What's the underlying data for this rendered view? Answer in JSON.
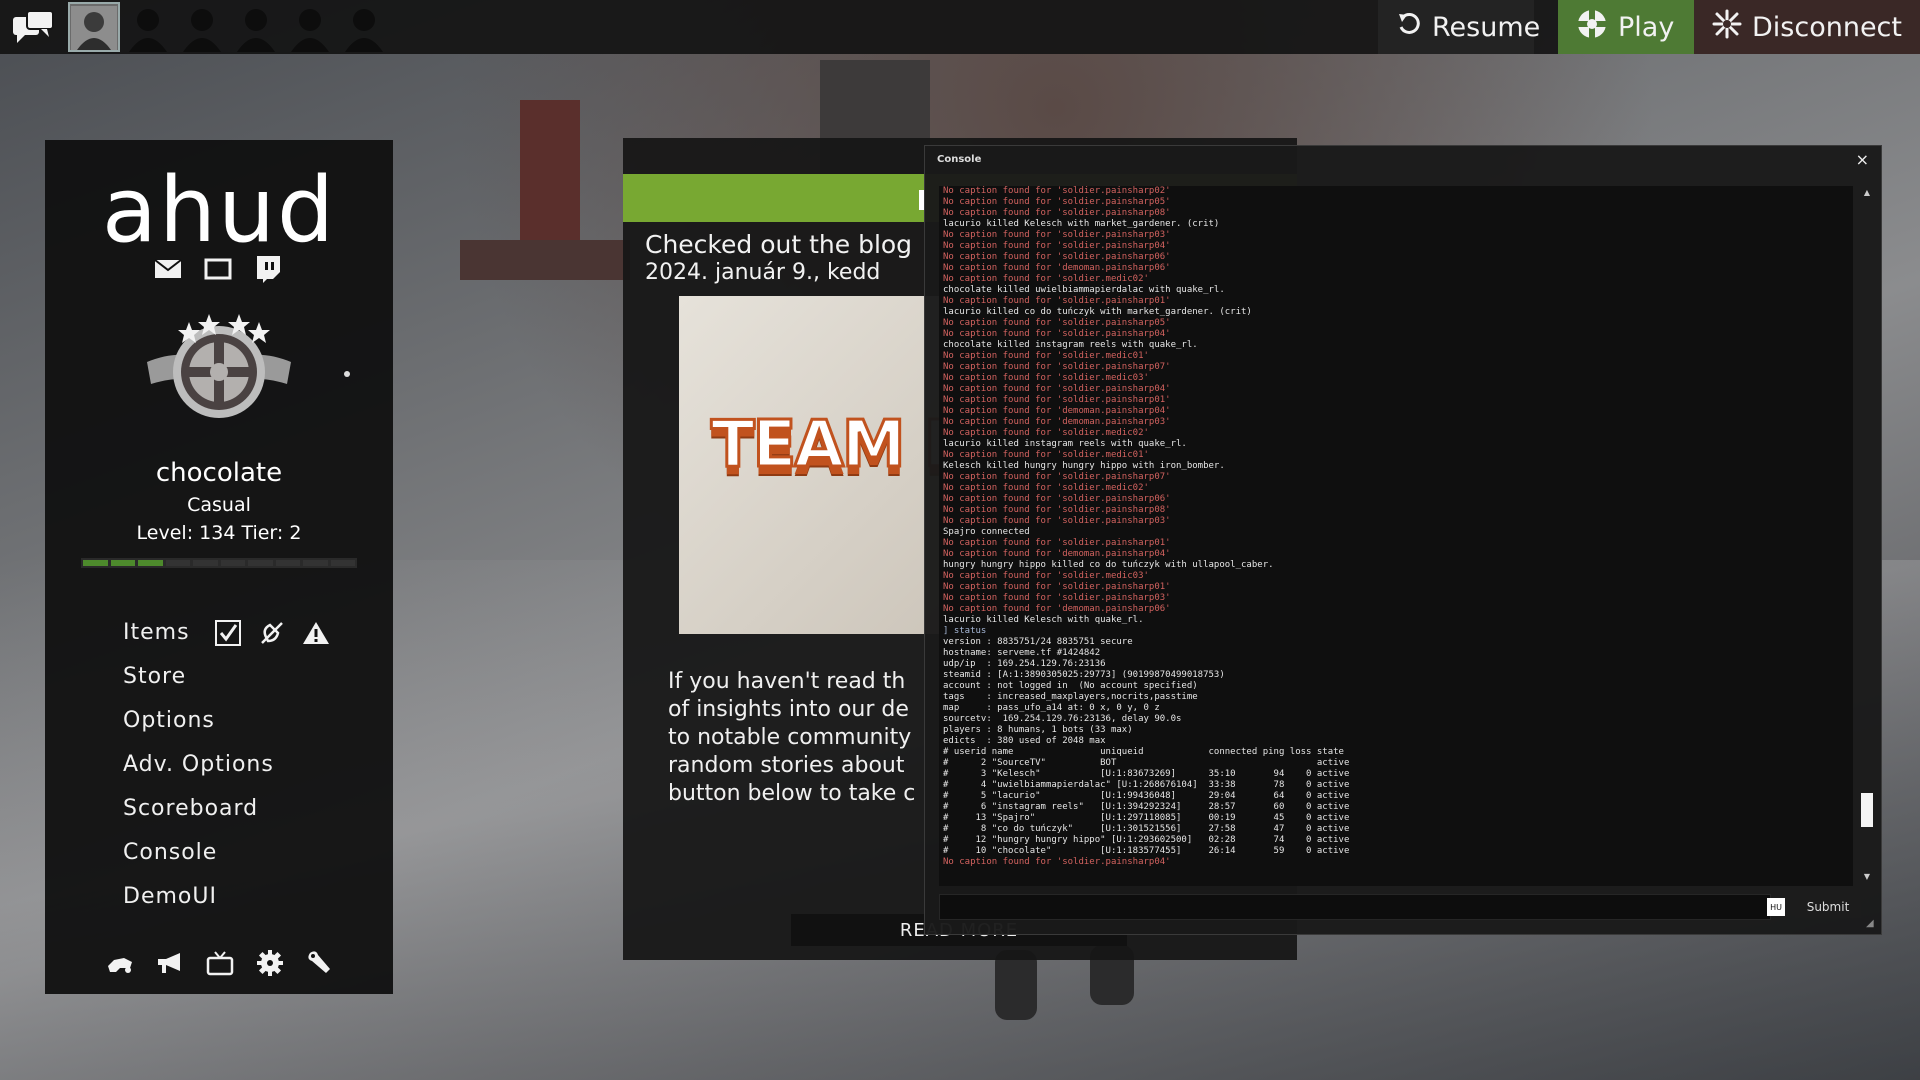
{
  "topbar": {
    "chat_icon": "chat-bubbles-icon",
    "friend_count": 5,
    "buttons": {
      "resume": "Resume",
      "play": "Play",
      "disconnect": "Disconnect"
    }
  },
  "menu": {
    "logo": "ahud",
    "player": {
      "name": "chocolate",
      "mode": "Casual",
      "level": "Level: 134 Tier: 2",
      "xp_segments_filled": 3,
      "xp_segments_total": 10
    },
    "items": [
      {
        "label": "Items"
      },
      {
        "label": "Store"
      },
      {
        "label": "Options"
      },
      {
        "label": "Adv. Options"
      },
      {
        "label": "Scoreboard"
      },
      {
        "label": "Console"
      },
      {
        "label": "DemoUI"
      }
    ]
  },
  "blog": {
    "title": "Checked out the blog",
    "date": "2024. január 9., kedd",
    "image_text": "TEAM FO",
    "body": [
      "If you haven't read th",
      "of insights into our de",
      "to notable community",
      "random stories about",
      "button below to take c"
    ],
    "read_more": "READ MORE"
  },
  "console": {
    "title": "Console",
    "close": "×",
    "lines": [
      {
        "t": "No caption found for 'soldier.painsharp02'",
        "k": "err"
      },
      {
        "t": "No caption found for 'soldier.painsharp05'",
        "k": "err"
      },
      {
        "t": "No caption found for 'soldier.painsharp08'",
        "k": "err"
      },
      {
        "t": "lacurio killed Kelesch with market_gardener. (crit)",
        "k": "ok"
      },
      {
        "t": "No caption found for 'soldier.painsharp03'",
        "k": "err"
      },
      {
        "t": "No caption found for 'soldier.painsharp04'",
        "k": "err"
      },
      {
        "t": "No caption found for 'soldier.painsharp06'",
        "k": "err"
      },
      {
        "t": "No caption found for 'demoman.painsharp06'",
        "k": "err"
      },
      {
        "t": "No caption found for 'soldier.medic02'",
        "k": "err"
      },
      {
        "t": "chocolate killed uwielbiammapierdalac with quake_rl.",
        "k": "ok"
      },
      {
        "t": "No caption found for 'soldier.painsharp01'",
        "k": "err"
      },
      {
        "t": "lacurio killed co do tuńczyk with market_gardener. (crit)",
        "k": "ok"
      },
      {
        "t": "No caption found for 'soldier.painsharp05'",
        "k": "err"
      },
      {
        "t": "No caption found for 'soldier.painsharp04'",
        "k": "err"
      },
      {
        "t": "chocolate killed instagram reels with quake_rl.",
        "k": "ok"
      },
      {
        "t": "No caption found for 'soldier.medic01'",
        "k": "err"
      },
      {
        "t": "No caption found for 'soldier.painsharp07'",
        "k": "err"
      },
      {
        "t": "No caption found for 'soldier.medic03'",
        "k": "err"
      },
      {
        "t": "No caption found for 'soldier.painsharp04'",
        "k": "err"
      },
      {
        "t": "No caption found for 'soldier.painsharp01'",
        "k": "err"
      },
      {
        "t": "No caption found for 'demoman.painsharp04'",
        "k": "err"
      },
      {
        "t": "No caption found for 'demoman.painsharp03'",
        "k": "err"
      },
      {
        "t": "No caption found for 'soldier.medic02'",
        "k": "err"
      },
      {
        "t": "lacurio killed instagram reels with quake_rl.",
        "k": "ok"
      },
      {
        "t": "No caption found for 'soldier.medic01'",
        "k": "err"
      },
      {
        "t": "Kelesch killed hungry hungry hippo with iron_bomber.",
        "k": "ok"
      },
      {
        "t": "No caption found for 'soldier.painsharp07'",
        "k": "err"
      },
      {
        "t": "No caption found for 'soldier.medic02'",
        "k": "err"
      },
      {
        "t": "No caption found for 'soldier.painsharp06'",
        "k": "err"
      },
      {
        "t": "No caption found for 'soldier.painsharp08'",
        "k": "err"
      },
      {
        "t": "No caption found for 'soldier.painsharp03'",
        "k": "err"
      },
      {
        "t": "Spajro connected",
        "k": "ok"
      },
      {
        "t": "No caption found for 'soldier.painsharp01'",
        "k": "err"
      },
      {
        "t": "No caption found for 'demoman.painsharp04'",
        "k": "err"
      },
      {
        "t": "hungry hungry hippo killed co do tuńczyk with ullapool_caber.",
        "k": "ok"
      },
      {
        "t": "No caption found for 'soldier.medic03'",
        "k": "err"
      },
      {
        "t": "No caption found for 'soldier.painsharp01'",
        "k": "err"
      },
      {
        "t": "No caption found for 'soldier.painsharp03'",
        "k": "err"
      },
      {
        "t": "No caption found for 'demoman.painsharp06'",
        "k": "err"
      },
      {
        "t": "lacurio killed Kelesch with quake_rl.",
        "k": "ok"
      },
      {
        "t": "] status",
        "k": "cmd"
      },
      {
        "t": "version : 8835751/24 8835751 secure",
        "k": "ok"
      },
      {
        "t": "hostname: serveme.tf #1424842",
        "k": "ok"
      },
      {
        "t": "udp/ip  : 169.254.129.76:23136",
        "k": "ok"
      },
      {
        "t": "steamid : [A:1:3890305025:29773] (90199870499018753)",
        "k": "ok"
      },
      {
        "t": "account : not logged in  (No account specified)",
        "k": "ok"
      },
      {
        "t": "tags    : increased_maxplayers,nocrits,passtime",
        "k": "ok"
      },
      {
        "t": "map     : pass_ufo_a14 at: 0 x, 0 y, 0 z",
        "k": "ok"
      },
      {
        "t": "sourcetv:  169.254.129.76:23136, delay 90.0s",
        "k": "ok"
      },
      {
        "t": "players : 8 humans, 1 bots (33 max)",
        "k": "ok"
      },
      {
        "t": "edicts  : 380 used of 2048 max",
        "k": "ok"
      },
      {
        "t": "# userid name                uniqueid            connected ping loss state",
        "k": "ok"
      },
      {
        "t": "#      2 \"SourceTV\"          BOT                                     active",
        "k": "ok"
      },
      {
        "t": "#      3 \"Kelesch\"           [U:1:83673269]      35:10       94    0 active",
        "k": "ok"
      },
      {
        "t": "#      4 \"uwielbiammapierdalac\" [U:1:268676104]  33:38       78    0 active",
        "k": "ok"
      },
      {
        "t": "#      5 \"lacurio\"           [U:1:99436048]      29:04       64    0 active",
        "k": "ok"
      },
      {
        "t": "#      6 \"instagram reels\"   [U:1:394292324]     28:57       60    0 active",
        "k": "ok"
      },
      {
        "t": "#     13 \"Spajro\"            [U:1:297118085]     00:19       45    0 active",
        "k": "ok"
      },
      {
        "t": "#      8 \"co do tuńczyk\"     [U:1:301521556]     27:58       47    0 active",
        "k": "ok"
      },
      {
        "t": "#     12 \"hungry hungry hippo\" [U:1:293602500]   02:28       74    0 active",
        "k": "ok"
      },
      {
        "t": "#     10 \"chocolate\"         [U:1:183577455]     26:14       59    0 active",
        "k": "ok"
      },
      {
        "t": "No caption found for 'soldier.painsharp04'",
        "k": "err"
      }
    ],
    "input_value": "",
    "hud_tag": "HU",
    "submit": "Submit",
    "scroll_position": 0.93
  }
}
